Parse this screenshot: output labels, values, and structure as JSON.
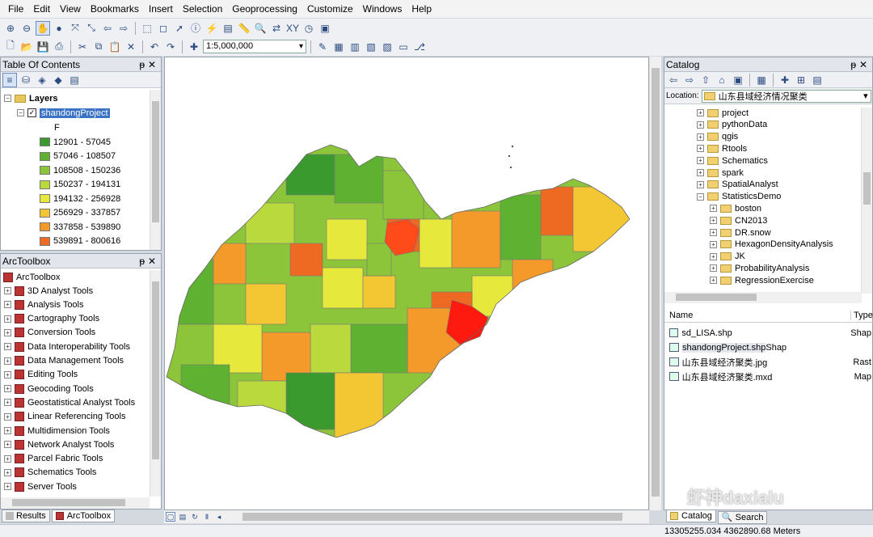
{
  "menu": [
    "File",
    "Edit",
    "View",
    "Bookmarks",
    "Insert",
    "Selection",
    "Geoprocessing",
    "Customize",
    "Windows",
    "Help"
  ],
  "toolbar": {
    "scale": "1:5,000,000"
  },
  "toc": {
    "title": "Table Of Contents",
    "layers_label": "Layers",
    "layer_name": "shandongProject",
    "field": "F",
    "classes": [
      {
        "label": "12901 - 57045",
        "color": "#3a9a2e"
      },
      {
        "label": "57046 - 108507",
        "color": "#5fb131"
      },
      {
        "label": "108508 - 150236",
        "color": "#8cc43a"
      },
      {
        "label": "150237 - 194131",
        "color": "#b9d93d"
      },
      {
        "label": "194132 - 256928",
        "color": "#e6e93c"
      },
      {
        "label": "256929 - 337857",
        "color": "#f2c733"
      },
      {
        "label": "337858 - 539890",
        "color": "#f39a2a"
      },
      {
        "label": "539891 - 800616",
        "color": "#ee6a22"
      }
    ]
  },
  "toolbox": {
    "title": "ArcToolbox",
    "root": "ArcToolbox",
    "items": [
      "3D Analyst Tools",
      "Analysis Tools",
      "Cartography Tools",
      "Conversion Tools",
      "Data Interoperability Tools",
      "Data Management Tools",
      "Editing Tools",
      "Geocoding Tools",
      "Geostatistical Analyst Tools",
      "Linear Referencing Tools",
      "Multidimension Tools",
      "Network Analyst Tools",
      "Parcel Fabric Tools",
      "Schematics Tools",
      "Server Tools"
    ],
    "tabs": [
      "Results",
      "ArcToolbox"
    ]
  },
  "catalog": {
    "title": "Catalog",
    "location_label": "Location:",
    "location": "山东县域经济情况聚类",
    "tree_top": [
      "project",
      "pythonData",
      "qgis",
      "Rtools",
      "Schematics",
      "spark",
      "SpatialAnalyst",
      "StatisticsDemo"
    ],
    "tree_sub": [
      "boston",
      "CN2013",
      "DR.snow",
      "HexagonDensityAnalysis",
      "JK",
      "ProbabilityAnalysis",
      "RegressionExercise"
    ],
    "col_name": "Name",
    "col_type": "Type",
    "files": [
      {
        "name": "sd_LISA.shp",
        "type": "Shap"
      },
      {
        "name": "shandongProject.shp",
        "type": "Shap"
      },
      {
        "name": "山东县域经济聚类.jpg",
        "type": "Rast"
      },
      {
        "name": "山东县域经济聚类.mxd",
        "type": "Map"
      }
    ],
    "tabs": [
      "Catalog",
      "Search"
    ]
  },
  "watermark": "虾神daxialu",
  "status": {
    "coords": "13305255.034  4362890.68 Meters"
  }
}
